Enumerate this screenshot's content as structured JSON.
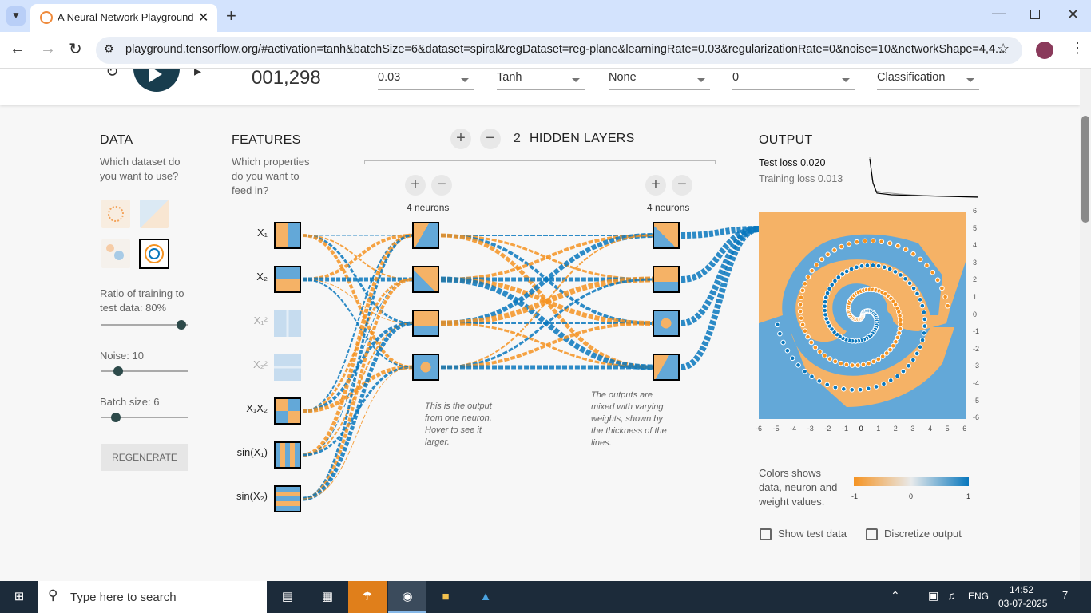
{
  "browser": {
    "tab_title": "A Neural Network Playground",
    "url": "playground.tensorflow.org/#activation=tanh&batchSize=6&dataset=spiral&regDataset=reg-plane&learningRate=0.03&regularizationRate=0&noise=10&networkShape=4,4..."
  },
  "controls": {
    "epoch": "001,298",
    "learning_rate": "0.03",
    "activation": "Tanh",
    "regularization": "None",
    "regularization_rate": "0",
    "problem_type": "Classification"
  },
  "data_panel": {
    "title": "DATA",
    "question": "Which dataset do you want to use?",
    "ratio_label": "Ratio of training to test data:  80%",
    "ratio_value": 0.8,
    "noise_label": "Noise:  10",
    "noise_value": 0.2,
    "batch_label": "Batch size:  6",
    "batch_value": 0.18,
    "regenerate": "REGENERATE"
  },
  "features_panel": {
    "title": "FEATURES",
    "question": "Which properties do you want to feed in?",
    "features": [
      {
        "label": "X₁",
        "active": true
      },
      {
        "label": "X₂",
        "active": true
      },
      {
        "label": "X₁²",
        "active": false
      },
      {
        "label": "X₂²",
        "active": false
      },
      {
        "label": "X₁X₂",
        "active": true
      },
      {
        "label": "sin(X₁)",
        "active": true
      },
      {
        "label": "sin(X₂)",
        "active": true
      }
    ]
  },
  "network": {
    "hidden_layers_count": "2",
    "hidden_layers_label": "HIDDEN LAYERS",
    "layer1_neurons": "4 neurons",
    "layer2_neurons": "4 neurons",
    "note1": "This is the output from one neuron. Hover to see it larger.",
    "note2": "The outputs are mixed with varying weights, shown by the thickness of the lines."
  },
  "output_panel": {
    "title": "OUTPUT",
    "test_loss_label": "Test loss",
    "test_loss": "0.020",
    "training_loss": "Training loss 0.013",
    "y_ticks": [
      "6",
      "5",
      "4",
      "3",
      "2",
      "1",
      "0",
      "-1",
      "-2",
      "-3",
      "-4",
      "-5",
      "-6"
    ],
    "x_ticks": [
      "-6",
      "-5",
      "-4",
      "-3",
      "-2",
      "-1",
      "0",
      "1",
      "2",
      "3",
      "4",
      "5",
      "6"
    ],
    "legend_text": "Colors shows data, neuron and weight values.",
    "legend_min": "-1",
    "legend_mid": "0",
    "legend_max": "1",
    "show_test_data": "Show test data",
    "discretize_output": "Discretize output"
  },
  "taskbar": {
    "search_placeholder": "Type here to search",
    "language": "ENG",
    "time": "14:52",
    "date": "03-07-2025",
    "notifications": "7"
  },
  "colors": {
    "orange": "#f59322",
    "blue": "#0877bd",
    "bg_orange": "#f5b266",
    "bg_blue": "#63a8d8"
  }
}
